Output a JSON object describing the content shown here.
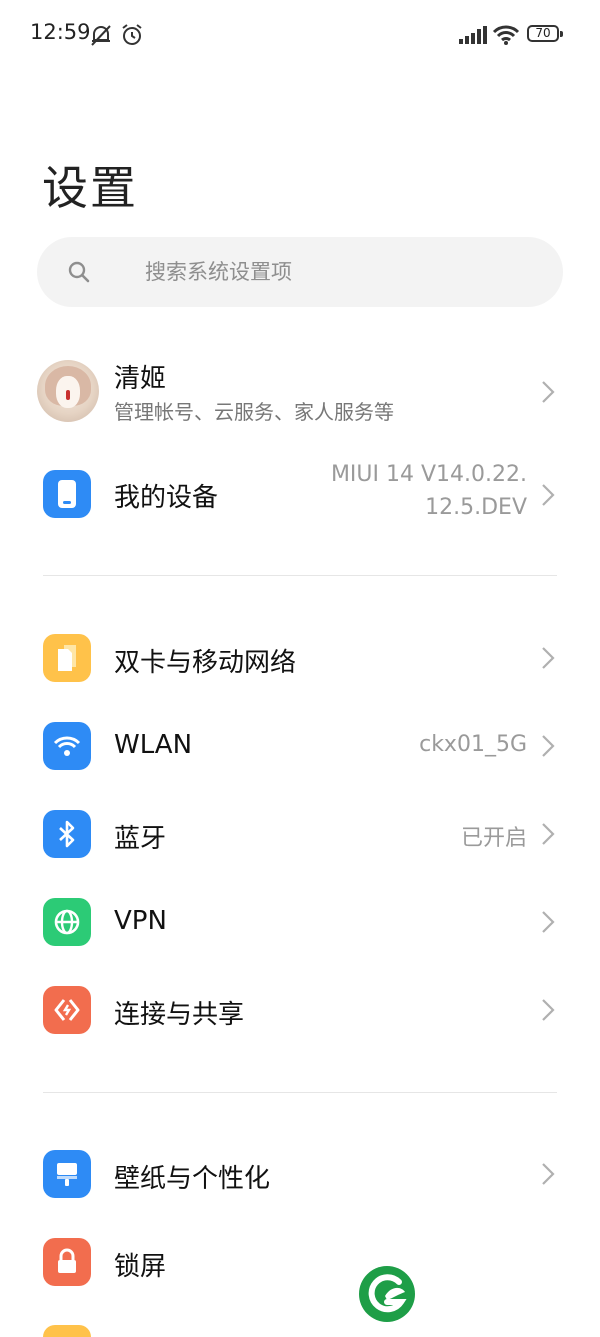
{
  "status_bar": {
    "time": "12:59",
    "battery": "70",
    "icons": [
      "mute-bell-icon",
      "alarm-icon",
      "signal-icon",
      "wifi-icon",
      "battery-icon"
    ]
  },
  "title": "设置",
  "search": {
    "placeholder": "搜索系统设置项"
  },
  "account": {
    "name": "清姬",
    "subtitle": "管理帐号、云服务、家人服务等"
  },
  "device": {
    "label": "我的设备",
    "value_line1": "MIUI 14 V14.0.22.",
    "value_line2": "12.5.DEV"
  },
  "network_section": [
    {
      "label": "双卡与移动网络",
      "value": "",
      "icon": "sim-card-icon",
      "color": "#FFC24A"
    },
    {
      "label": "WLAN",
      "value": "ckx01_5G",
      "icon": "wifi-icon",
      "color": "#2E8BF5"
    },
    {
      "label": "蓝牙",
      "value": "已开启",
      "icon": "bluetooth-icon",
      "color": "#2E8BF5"
    },
    {
      "label": "VPN",
      "value": "",
      "icon": "globe-icon",
      "color": "#2CCB76"
    },
    {
      "label": "连接与共享",
      "value": "",
      "icon": "share-icon",
      "color": "#F26D4E"
    }
  ],
  "display_section": [
    {
      "label": "壁纸与个性化",
      "icon": "wallpaper-icon",
      "color": "#2E8BF5"
    },
    {
      "label": "锁屏",
      "icon": "lock-icon",
      "color": "#F26D4E"
    }
  ],
  "colors": {
    "accent_blue": "#2E8BF5",
    "yellow": "#FFC24A",
    "green": "#2CCB76",
    "orange": "#F26D4E",
    "watermark_green": "#1E9E47"
  }
}
